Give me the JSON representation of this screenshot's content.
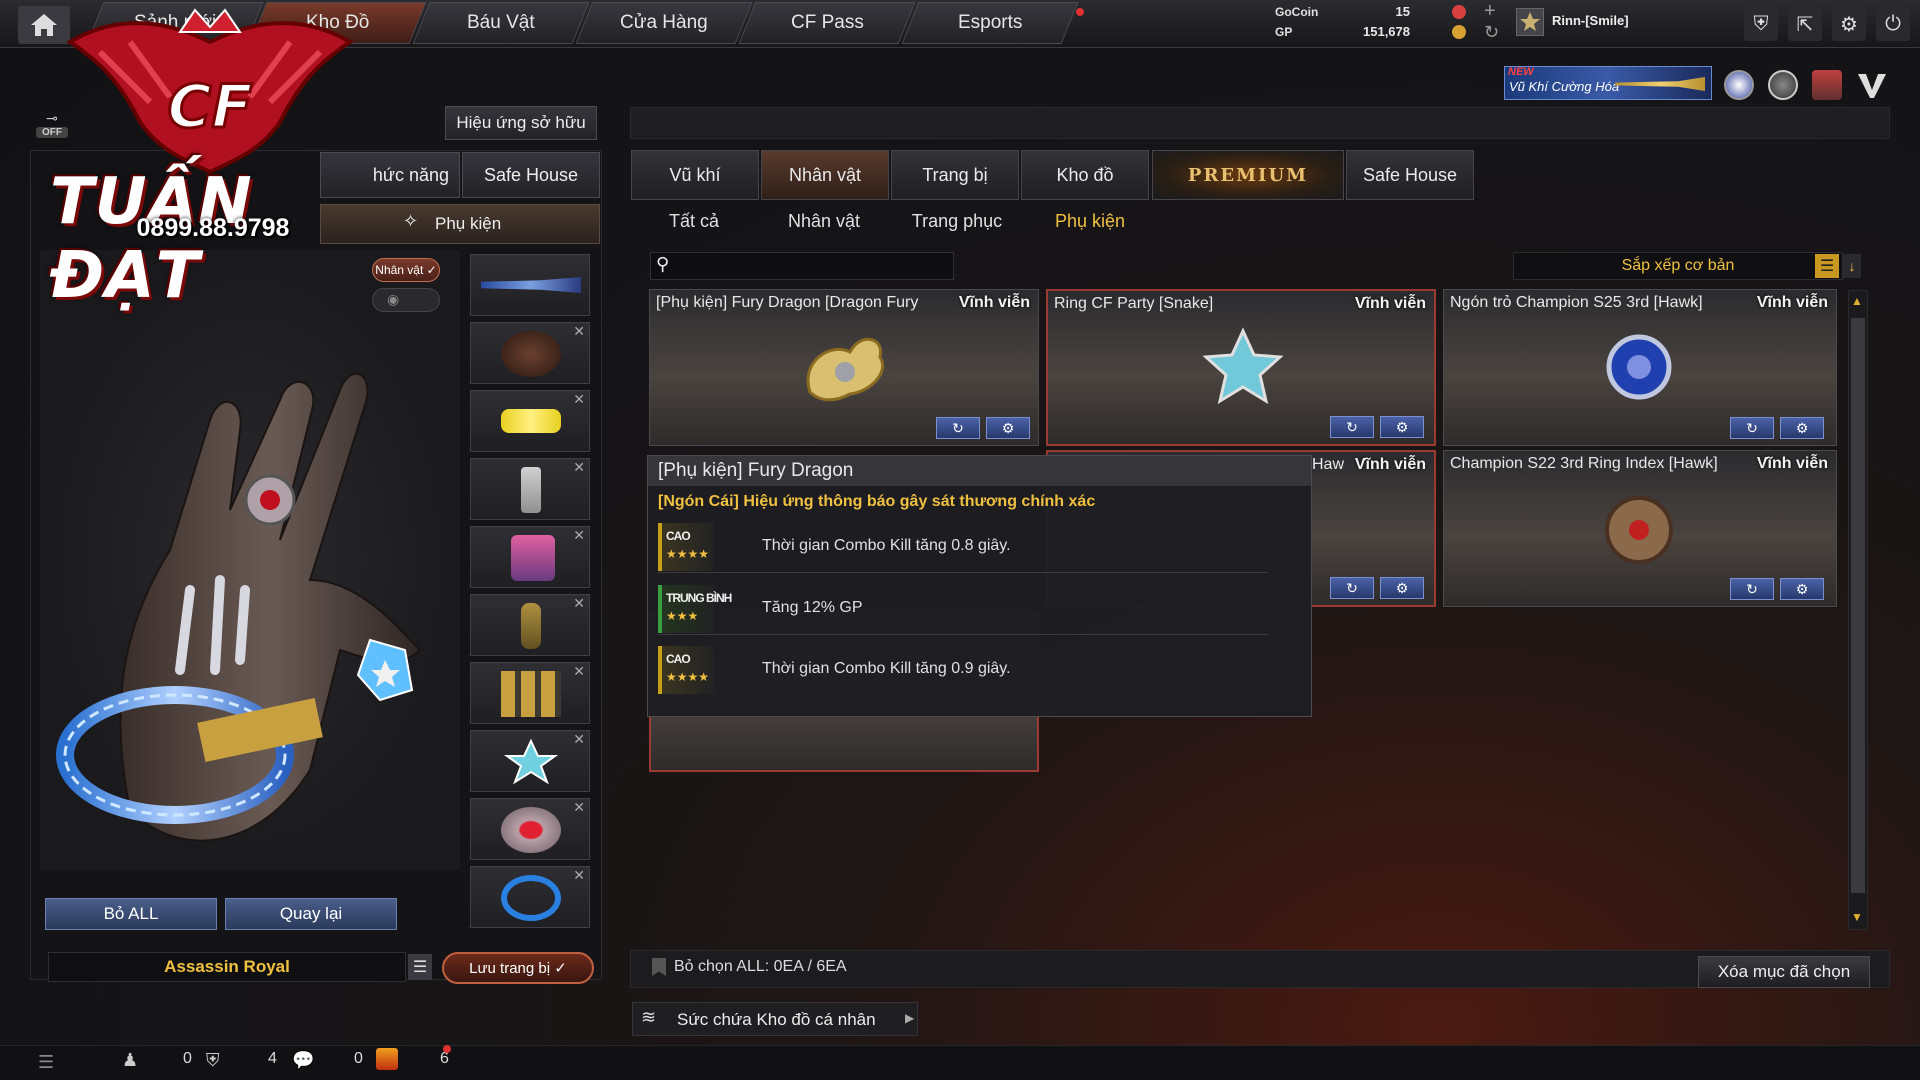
{
  "topnav": {
    "tabs": [
      "Sảnh mới",
      "Kho Đồ",
      "Báu Vật",
      "Cửa Hàng",
      "CF Pass",
      "Esports"
    ]
  },
  "currency": {
    "gocoin_label": "GoCoin",
    "gocoin_value": "15",
    "gp_label": "GP",
    "gp_value": "151,678"
  },
  "user": {
    "name": "Rinn-[Smile]"
  },
  "banner": {
    "badge": "NEW",
    "text": "Vũ Khí Cường Hóa"
  },
  "watermark": {
    "name": "TUẤN ĐẠT",
    "phone": "0899.88.9798"
  },
  "left": {
    "off_label": "OFF",
    "effect_button": "Hiệu ứng sở hữu",
    "tab_function": "hức năng",
    "tab_safehouse": "Safe House",
    "subtab_accessory": "Phụ kiện",
    "character_toggle": "Nhân vật ✓",
    "remove_all": "Bỏ ALL",
    "back": "Quay lại",
    "loadout_name": "Assassin Royal",
    "save_loadout": "Lưu trang bị ✓"
  },
  "right": {
    "tabs": [
      "Vũ khí",
      "Nhân vật",
      "Trang bị",
      "Kho đồ",
      "PREMIUM",
      "Safe House"
    ],
    "subtabs": [
      "Tất cả",
      "Nhân vật",
      "Trang phục",
      "Phụ kiện"
    ],
    "search_placeholder": "",
    "sort_label": "Sắp xếp cơ bản",
    "cards": [
      {
        "name": "[Phụ kiện] Fury Dragon [Dragon Fury",
        "duration": "Vĩnh viễn"
      },
      {
        "name": "Ring CF Party [Snake]",
        "duration": "Vĩnh viễn"
      },
      {
        "name": "Ngón trỏ Champion S25 3rd [Hawk]",
        "duration": "Vĩnh viễn"
      },
      {
        "name": "Haw",
        "duration": "Vĩnh viễn"
      },
      {
        "name": "Champion S22 3rd Ring Index [Hawk]",
        "duration": "Vĩnh viễn"
      }
    ],
    "deselect_all": "Bỏ chọn ALL: 0EA / 6EA",
    "delete_selected": "Xóa mục đã chọn",
    "capacity": "Sức chứa Kho đồ cá nhân"
  },
  "tooltip": {
    "title": "[Phụ kiện] Fury Dragon",
    "subtitle": "[Ngón Cái] Hiệu ứng thông báo gây sát thương chính xác",
    "rows": [
      {
        "level": "CAO",
        "stars": "★★★★",
        "desc": "Thời gian Combo Kill tăng 0.8 giây."
      },
      {
        "level": "TRUNG BÌNH",
        "stars": "★★★",
        "desc": "Tăng 12% GP"
      },
      {
        "level": "CAO",
        "stars": "★★★★",
        "desc": "Thời gian Combo Kill tăng 0.9 giây."
      }
    ]
  },
  "status": {
    "shield": "0",
    "chat": "4",
    "gift": "0",
    "notif": "6"
  },
  "colors": {
    "accent": "#f0c040",
    "button_blue": "#3a4e7c",
    "selected_border": "#9a3a32"
  }
}
